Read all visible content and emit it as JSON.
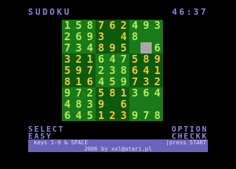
{
  "title": "SUDOKU",
  "clock": "46:37",
  "board": {
    "rows": [
      [
        "1",
        "5",
        "8",
        "7",
        "6",
        "2",
        "4",
        "9",
        "3"
      ],
      [
        "2",
        "6",
        "9",
        "3",
        "",
        "4",
        "8",
        "",
        ""
      ],
      [
        "7",
        "3",
        "4",
        "8",
        "9",
        "5",
        "",
        "",
        "6"
      ],
      [
        "3",
        "2",
        "1",
        "6",
        "4",
        "7",
        "5",
        "8",
        "9"
      ],
      [
        "5",
        "9",
        "7",
        "2",
        "3",
        "8",
        "6",
        "4",
        "1"
      ],
      [
        "8",
        "1",
        "6",
        "4",
        "5",
        "9",
        "7",
        "3",
        "2"
      ],
      [
        "9",
        "7",
        "2",
        "5",
        "8",
        "1",
        "3",
        "6",
        "4"
      ],
      [
        "4",
        "8",
        "3",
        "9",
        "",
        "6",
        "",
        "",
        ""
      ],
      [
        "6",
        "4",
        "5",
        "1",
        "2",
        "3",
        "9",
        "7",
        "8"
      ]
    ],
    "cursor": {
      "row": 2,
      "col": 7
    },
    "colors": {
      "board": "#1a7a1a",
      "alt_block": "#0c5a0c",
      "given": "#f0c840",
      "entry": "#b8e860",
      "cursor": "#a8a8a8"
    }
  },
  "menu": {
    "select_label": "SELECT",
    "level_value": "EASY",
    "option_label": "OPTION",
    "check_label": "CHECKK"
  },
  "footer": {
    "help_left": "keys 1-9 & SPACE",
    "help_right": "|press START",
    "credit": "2006 by xxl@atari.pl"
  }
}
